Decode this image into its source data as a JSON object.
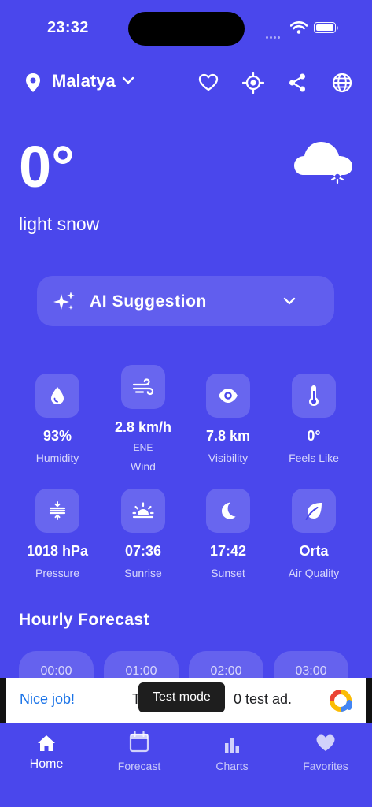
{
  "status_bar": {
    "time": "23:32"
  },
  "header": {
    "city": "Malatya"
  },
  "current": {
    "temperature": "0°",
    "condition": "light snow"
  },
  "ai_suggestion": {
    "label": "AI Suggestion"
  },
  "metrics": [
    {
      "value": "93%",
      "label": "Humidity",
      "icon": "humidity-drop-icon"
    },
    {
      "value": "2.8 km/h",
      "sub": "ENE",
      "label": "Wind",
      "icon": "wind-icon"
    },
    {
      "value": "7.8 km",
      "label": "Visibility",
      "icon": "eye-icon"
    },
    {
      "value": "0°",
      "label": "Feels Like",
      "icon": "thermometer-icon"
    },
    {
      "value": "1018 hPa",
      "label": "Pressure",
      "icon": "pressure-icon"
    },
    {
      "value": "07:36",
      "label": "Sunrise",
      "icon": "sunrise-icon"
    },
    {
      "value": "17:42",
      "label": "Sunset",
      "icon": "moon-icon"
    },
    {
      "value": "Orta",
      "label": "Air Quality",
      "icon": "leaf-icon"
    }
  ],
  "hourly": {
    "title": "Hourly Forecast",
    "hours": [
      "00:00",
      "01:00",
      "02:00",
      "03:00"
    ]
  },
  "ad": {
    "brand_text": "Nice job!",
    "text_start": "T",
    "text_end": "0 test ad.",
    "toast": "Test mode"
  },
  "tabs": [
    {
      "label": "Home",
      "icon": "home-icon",
      "active": true
    },
    {
      "label": "Forecast",
      "icon": "calendar-icon",
      "active": false
    },
    {
      "label": "Charts",
      "icon": "bar-chart-icon",
      "active": false
    },
    {
      "label": "Favorites",
      "icon": "heart-icon",
      "active": false
    }
  ],
  "colors": {
    "background": "#4a47ec",
    "ad_link": "#1a73e8"
  }
}
